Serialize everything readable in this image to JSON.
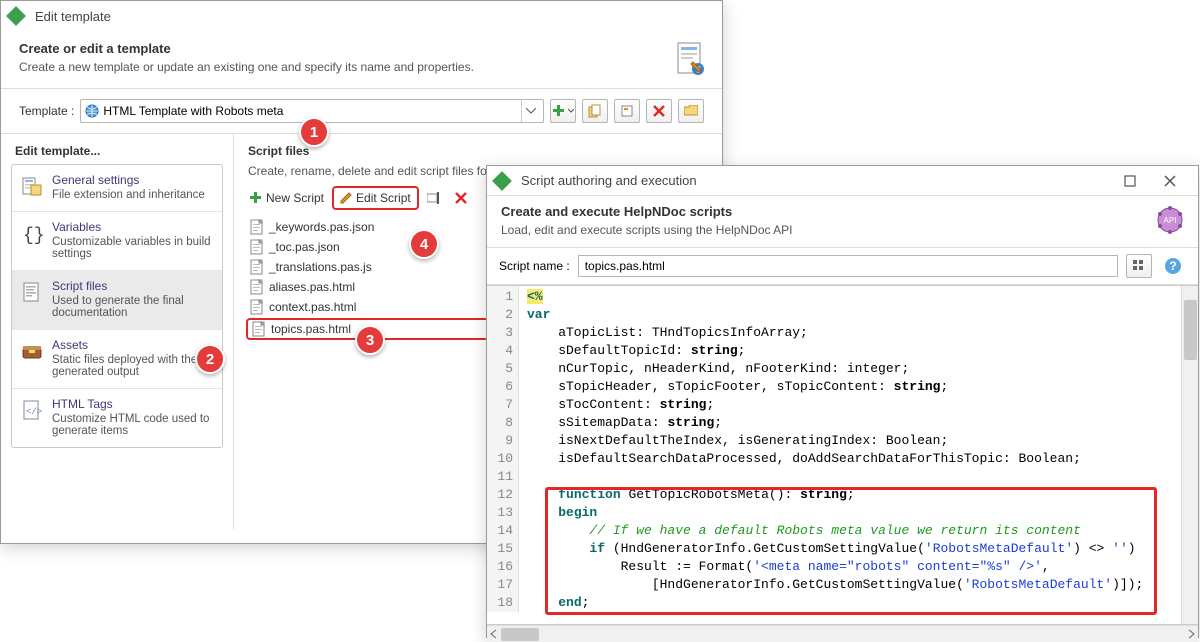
{
  "main": {
    "title": "Edit template",
    "headerTitle": "Create or edit a template",
    "headerSub": "Create a new template or update an existing one and specify its name and properties.",
    "templateLabel": "Template :",
    "templateValue": "HTML Template with Robots meta",
    "leftColTitle": "Edit template...",
    "sideItems": [
      {
        "title": "General settings",
        "desc": "File extension and inheritance"
      },
      {
        "title": "Variables",
        "desc": "Customizable variables in build settings"
      },
      {
        "title": "Script files",
        "desc": "Used to generate the final documentation",
        "selected": true
      },
      {
        "title": "Assets",
        "desc": "Static files deployed with the generated output"
      },
      {
        "title": "HTML Tags",
        "desc": "Customize HTML code used to generate items"
      }
    ],
    "midColTitle": "Script files",
    "midColSub": "Create, rename, delete and edit script files for th",
    "scriptToolbar": {
      "newScript": "New Script",
      "editScript": "Edit Script"
    },
    "files": [
      "_keywords.pas.json",
      "_toc.pas.json",
      "_translations.pas.js",
      "aliases.pas.html",
      "context.pas.html",
      "topics.pas.html"
    ],
    "highlightFileIndex": 5,
    "steps": {
      "s1": "1",
      "s2": "2",
      "s3": "3",
      "s4": "4"
    }
  },
  "scriptWin": {
    "title": "Script authoring and execution",
    "headerTitle": "Create and execute HelpNDoc scripts",
    "headerSub": "Load, edit and execute scripts using the HelpNDoc API",
    "scriptNameLabel": "Script name :",
    "scriptNameValue": "topics.pas.html",
    "gearLabel": "API",
    "code": {
      "lineCount": 18,
      "lines": [
        {
          "n": 1,
          "segs": [
            {
              "t": "<%",
              "cls": "hl-yel kw-nav"
            }
          ]
        },
        {
          "n": 2,
          "segs": [
            {
              "t": "var",
              "cls": "kw-nav"
            }
          ]
        },
        {
          "n": 3,
          "segs": [
            {
              "t": "    aTopicList: THndTopicsInfoArray;",
              "cls": ""
            }
          ]
        },
        {
          "n": 4,
          "segs": [
            {
              "t": "    sDefaultTopicId: ",
              "cls": ""
            },
            {
              "t": "string",
              "cls": "kw-bold"
            },
            {
              "t": ";",
              "cls": ""
            }
          ]
        },
        {
          "n": 5,
          "segs": [
            {
              "t": "    nCurTopic, nHeaderKind, nFooterKind: integer;",
              "cls": ""
            }
          ]
        },
        {
          "n": 6,
          "segs": [
            {
              "t": "    sTopicHeader, sTopicFooter, sTopicContent: ",
              "cls": ""
            },
            {
              "t": "string",
              "cls": "kw-bold"
            },
            {
              "t": ";",
              "cls": ""
            }
          ]
        },
        {
          "n": 7,
          "segs": [
            {
              "t": "    sTocContent: ",
              "cls": ""
            },
            {
              "t": "string",
              "cls": "kw-bold"
            },
            {
              "t": ";",
              "cls": ""
            }
          ]
        },
        {
          "n": 8,
          "segs": [
            {
              "t": "    sSitemapData: ",
              "cls": ""
            },
            {
              "t": "string",
              "cls": "kw-bold"
            },
            {
              "t": ";",
              "cls": ""
            }
          ]
        },
        {
          "n": 9,
          "segs": [
            {
              "t": "    isNextDefaultTheIndex, isGeneratingIndex: Boolean;",
              "cls": ""
            }
          ]
        },
        {
          "n": 10,
          "segs": [
            {
              "t": "    isDefaultSearchDataProcessed, doAddSearchDataForThisTopic: Boolean;",
              "cls": ""
            }
          ]
        },
        {
          "n": 11,
          "segs": [
            {
              "t": "",
              "cls": ""
            }
          ]
        },
        {
          "n": 12,
          "segs": [
            {
              "t": "    ",
              "cls": ""
            },
            {
              "t": "function",
              "cls": "kw-nav"
            },
            {
              "t": " GetTopicRobotsMeta(): ",
              "cls": ""
            },
            {
              "t": "string",
              "cls": "kw-bold"
            },
            {
              "t": ";",
              "cls": ""
            }
          ]
        },
        {
          "n": 13,
          "segs": [
            {
              "t": "    ",
              "cls": ""
            },
            {
              "t": "begin",
              "cls": "kw-nav"
            }
          ]
        },
        {
          "n": 14,
          "segs": [
            {
              "t": "        ",
              "cls": ""
            },
            {
              "t": "// If we have a default Robots meta value we return its content",
              "cls": "cm-comment"
            }
          ]
        },
        {
          "n": 15,
          "segs": [
            {
              "t": "        ",
              "cls": ""
            },
            {
              "t": "if",
              "cls": "kw-nav"
            },
            {
              "t": " (HndGeneratorInfo.GetCustomSettingValue(",
              "cls": ""
            },
            {
              "t": "'RobotsMetaDefault'",
              "cls": "cm-str"
            },
            {
              "t": ") <> ",
              "cls": ""
            },
            {
              "t": "''",
              "cls": "cm-str"
            },
            {
              "t": ")",
              "cls": ""
            }
          ]
        },
        {
          "n": 16,
          "segs": [
            {
              "t": "            Result := Format(",
              "cls": ""
            },
            {
              "t": "'<meta name=\"robots\" content=\"%s\" />'",
              "cls": "cm-str"
            },
            {
              "t": ",",
              "cls": ""
            }
          ]
        },
        {
          "n": 17,
          "segs": [
            {
              "t": "                [HndGeneratorInfo.GetCustomSettingValue(",
              "cls": ""
            },
            {
              "t": "'RobotsMetaDefault'",
              "cls": "cm-str"
            },
            {
              "t": ")]);",
              "cls": ""
            }
          ]
        },
        {
          "n": 18,
          "segs": [
            {
              "t": "    ",
              "cls": ""
            },
            {
              "t": "end",
              "cls": "kw-nav"
            },
            {
              "t": ";",
              "cls": ""
            }
          ]
        }
      ]
    }
  }
}
